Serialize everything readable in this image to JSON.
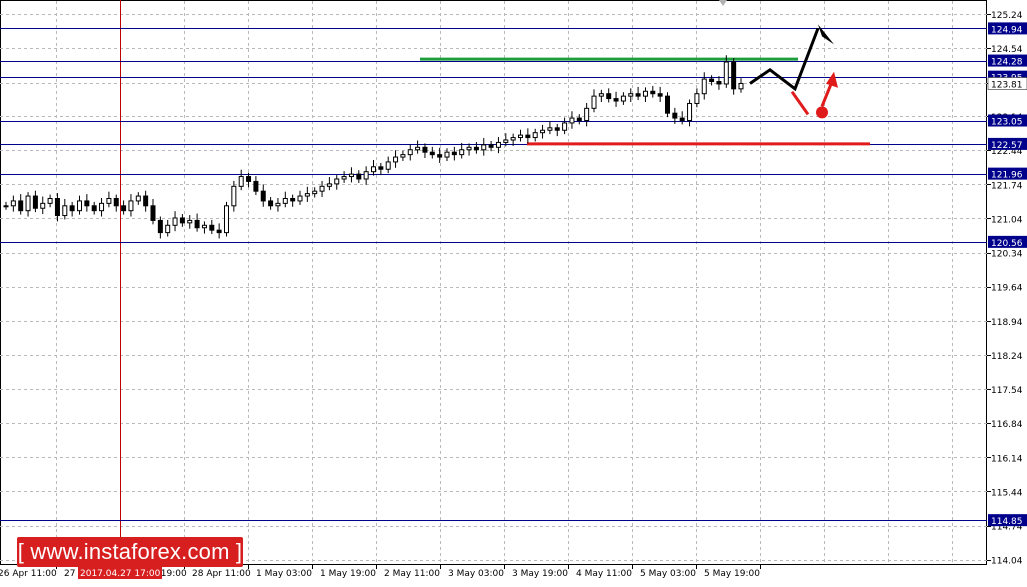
{
  "chart_data": {
    "type": "candlestick",
    "title": "",
    "xlabel": "",
    "ylabel": "",
    "ylim": [
      113.93,
      125.42
    ],
    "grid": true,
    "price_ticks": [
      "125.24",
      "124.54",
      "123.81",
      "123.14",
      "122.44",
      "121.74",
      "121.04",
      "120.34",
      "119.64",
      "118.94",
      "118.24",
      "117.54",
      "116.84",
      "116.14",
      "115.44",
      "114.74",
      "114.04"
    ],
    "price_tick_values": [
      125.24,
      124.54,
      123.81,
      123.14,
      122.44,
      121.74,
      121.04,
      120.34,
      119.64,
      118.94,
      118.24,
      117.54,
      116.84,
      116.14,
      115.44,
      114.74,
      114.04
    ],
    "time_labels": [
      "26 Apr 11:00",
      "27 Apr 03:00",
      "27 Apr 19:00",
      "28 Apr 11:00",
      "1 May 03:00",
      "1 May 19:00",
      "2 May 11:00",
      "3 May 03:00",
      "3 May 19:00",
      "4 May 11:00",
      "5 May 03:00",
      "5 May 19:00"
    ],
    "crosshair_label": "2017.04.27 17:00",
    "levels": [
      {
        "label": "124.94",
        "value": 124.94,
        "color": "#00008b"
      },
      {
        "label": "124.28",
        "value": 124.28,
        "color": "#00008b"
      },
      {
        "label": "123.95",
        "value": 123.95,
        "color": "#00008b"
      },
      {
        "label": "123.05",
        "value": 123.05,
        "color": "#00008b"
      },
      {
        "label": "122.57",
        "value": 122.57,
        "color": "#00008b"
      },
      {
        "label": "121.96",
        "value": 121.96,
        "color": "#00008b"
      },
      {
        "label": "120.56",
        "value": 120.56,
        "color": "#00008b"
      },
      {
        "label": "114.85",
        "value": 114.85,
        "color": "#00008b"
      }
    ],
    "current_price": {
      "label": "123.81",
      "value": 123.81
    },
    "support_line": {
      "value": 122.57,
      "color": "#e01b1b"
    },
    "resistance_line": {
      "value": 124.31,
      "color": "#1e9e3a"
    },
    "closes": [
      121.3,
      121.4,
      121.2,
      121.5,
      121.25,
      121.35,
      121.45,
      121.1,
      121.3,
      121.2,
      121.4,
      121.3,
      121.2,
      121.35,
      121.45,
      121.3,
      121.2,
      121.4,
      121.5,
      121.3,
      121.0,
      120.75,
      120.9,
      121.05,
      120.95,
      121.0,
      120.85,
      120.9,
      120.8,
      120.75,
      121.3,
      121.7,
      121.9,
      121.8,
      121.6,
      121.4,
      121.3,
      121.35,
      121.45,
      121.4,
      121.5,
      121.55,
      121.6,
      121.7,
      121.75,
      121.85,
      121.9,
      121.95,
      121.85,
      122.0,
      122.1,
      122.05,
      122.2,
      122.3,
      122.35,
      122.45,
      122.5,
      122.4,
      122.35,
      122.3,
      122.4,
      122.35,
      122.45,
      122.5,
      122.45,
      122.55,
      122.5,
      122.6,
      122.65,
      122.7,
      122.75,
      122.7,
      122.8,
      122.85,
      122.9,
      122.85,
      123.0,
      123.1,
      123.05,
      123.3,
      123.55,
      123.6,
      123.5,
      123.45,
      123.55,
      123.6,
      123.55,
      123.65,
      123.6,
      123.55,
      123.2,
      123.1,
      123.05,
      123.4,
      123.6,
      123.9,
      123.85,
      123.8,
      124.25,
      123.7,
      123.81
    ],
    "forecast_path": [
      123.81,
      124.09,
      123.7,
      124.94,
      124.78
    ],
    "correction_marker": {
      "from": 123.3,
      "to": 123.6
    }
  },
  "watermark": {
    "text": "www.instaforex.com"
  }
}
